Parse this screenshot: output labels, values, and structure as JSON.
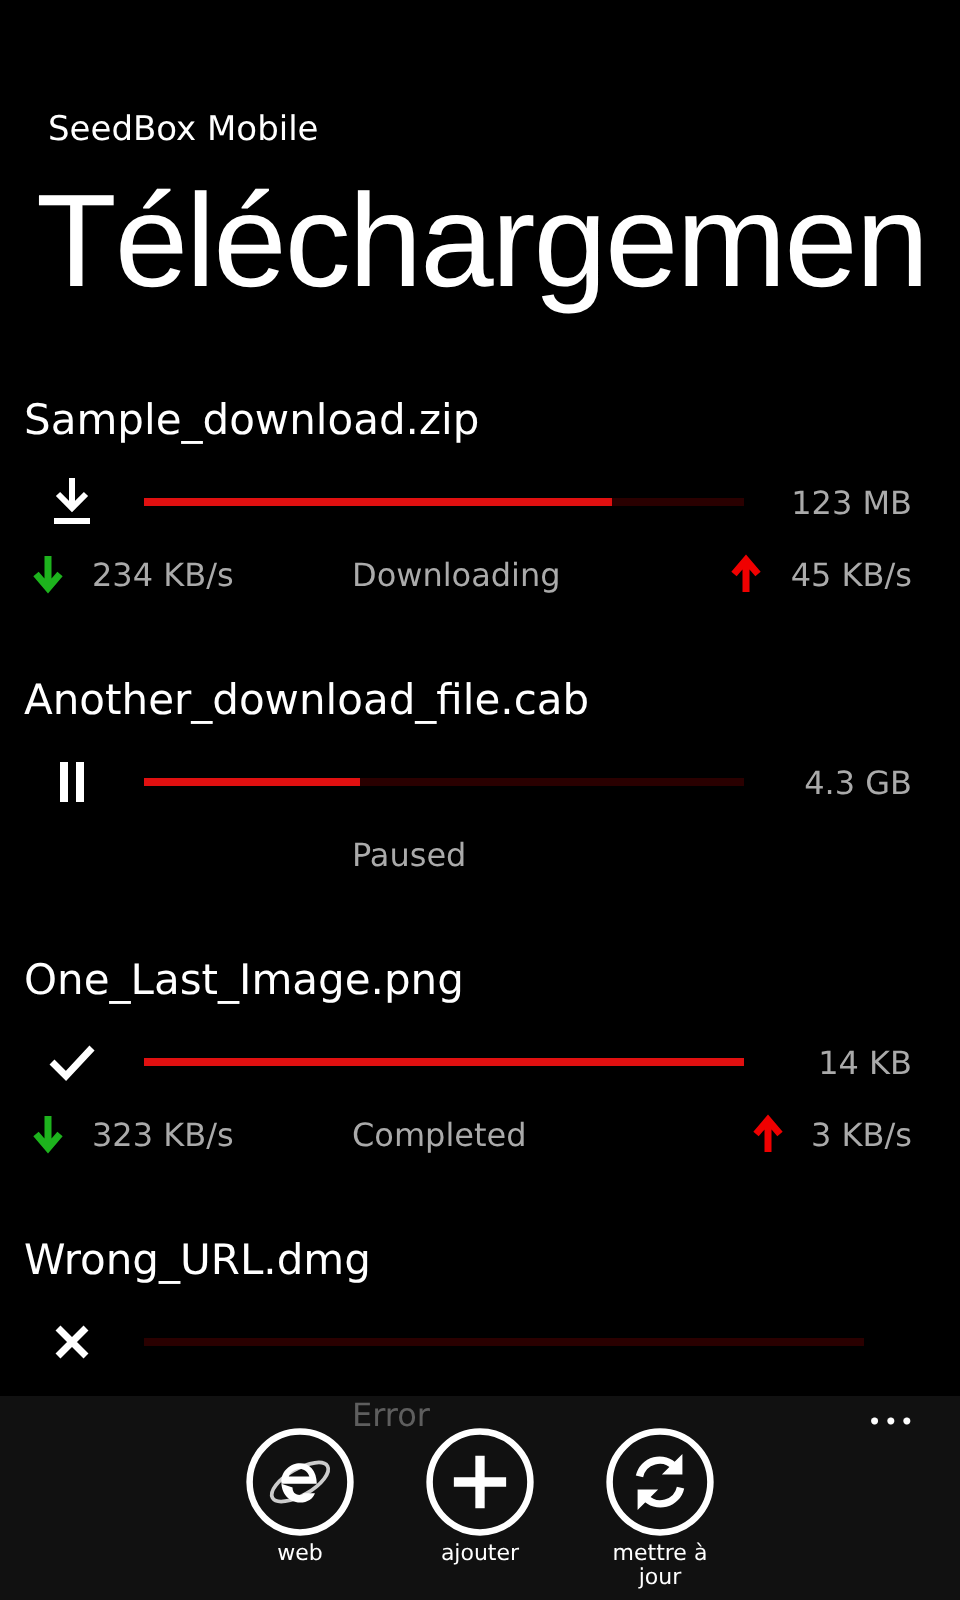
{
  "app_title": "SeedBox Mobile",
  "page_title": "Téléchargemen",
  "downloads": [
    {
      "name": "Sample_download.zip",
      "kind": "downloading",
      "level": 0.78,
      "size": "123 MB",
      "down_speed": "234 KB/s",
      "status": "Downloading",
      "up_speed": "45 KB/s"
    },
    {
      "name": "Another_download_file.cab",
      "kind": "paused",
      "level": 0.36,
      "size": "4.3 GB",
      "status": "Paused"
    },
    {
      "name": "One_Last_Image.png",
      "kind": "completed",
      "level": 1,
      "size": "14 KB",
      "down_speed": "323 KB/s",
      "status": "Completed",
      "up_speed": "3 KB/s"
    },
    {
      "name": "Wrong_URL.dmg",
      "kind": "error",
      "level": 0,
      "status": "Error"
    }
  ],
  "app_bar": {
    "more": "•••",
    "buttons": [
      {
        "kind": "web",
        "label": "web"
      },
      {
        "kind": "add",
        "label": "ajouter"
      },
      {
        "kind": "refresh",
        "label": "mettre à jour"
      }
    ]
  }
}
